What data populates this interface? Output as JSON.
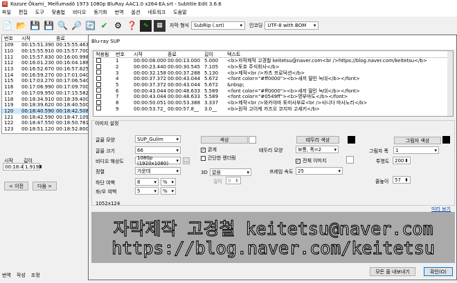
{
  "app": {
    "icon": "SE",
    "title": "Kozure Ōkami_ Meifumadō 1973 1080p BluRay AAC1.0 x264-EA.srt - Subtitle Edit 3.6.6"
  },
  "menu": [
    "파일",
    "편집",
    "도구",
    "맞춤법",
    "비디오",
    "동기화",
    "번역",
    "옵션",
    "네트워크",
    "도움말"
  ],
  "toolbar": {
    "format_label": "자막 형식",
    "format_value": "SubRip (.srt)",
    "encoding_label": "인코딩",
    "encoding_value": "UTF-8 with BOM",
    "icons": [
      "new-file-icon",
      "open-folder-icon",
      "save-icon",
      "save-as-icon",
      "find-icon",
      "replace-icon",
      "sync-icon",
      "spellcheck-icon",
      "settings-icon",
      "help-icon",
      "waveform-icon",
      "video-icon"
    ]
  },
  "left_grid": {
    "headers": [
      "번호",
      "시작",
      "종료"
    ],
    "rows": [
      [
        "109",
        "00:15:51.390",
        "00:15:55.463"
      ],
      [
        "110",
        "00:15:55.910",
        "00:15:57.700"
      ],
      [
        "111",
        "00:15:57.830",
        "00:16:00.998"
      ],
      [
        "112",
        "00:16:01.230",
        "00:16:04.188"
      ],
      [
        "113",
        "00:16:52.670",
        "00:16:57.825"
      ],
      [
        "114",
        "00:16:59.270",
        "00:17:01.040"
      ],
      [
        "115",
        "00:17:03.270",
        "00:17:06.540"
      ],
      [
        "116",
        "00:17:06.990",
        "00:17:09.700"
      ],
      [
        "117",
        "00:17:09.950",
        "00:17:15.582"
      ],
      [
        "118",
        "00:18:34.910",
        "00:18:39.400"
      ],
      [
        "119",
        "00:18:39.620",
        "00:18:40.500"
      ],
      [
        "120",
        "00:18:40.590",
        "00:18:42.508"
      ],
      [
        "121",
        "00:18:42.590",
        "00:18:47.109"
      ],
      [
        "122",
        "00:18:47.550",
        "00:18:50.781"
      ],
      [
        "123",
        "00:18:51.120",
        "00:18:52.800"
      ]
    ],
    "selected_index": 11
  },
  "left_edit": {
    "start_label": "시작",
    "start_value": "00:18:40.590",
    "dur_label": "길이",
    "dur_value": "1.919",
    "prev": "< 이전",
    "next": "다음 >"
  },
  "bottom_tabs": [
    "번역",
    "작성",
    "조정"
  ],
  "dialog": {
    "title": "Blu-ray SUP",
    "grid_headers": [
      "적용됨",
      "번호",
      "시작",
      "종료",
      "길이",
      "텍스트"
    ],
    "grid_rows": [
      [
        "1",
        "00:00:08.000",
        "00:00:13.000",
        "5.000",
        "<b>자막제작 고경철 keitetsu@naver.com<br />https://blog.naver.com/keitetsu</b>"
      ],
      [
        "2",
        "00:00:23.440",
        "00:00:30.545",
        "7.105",
        "<b>토호 주식회사</b>"
      ],
      [
        "3",
        "00:00:32.158",
        "00:00:37.288",
        "5.130",
        "<b>제작<br />카츠 프로덕션</b>"
      ],
      [
        "4",
        "00:00:37.372",
        "00:00:43.044",
        "5.672",
        "<font color=\"#ff0000\"><b>새끼 딸린 늑대</b></font>"
      ],
      [
        "5",
        "00:00:37.372",
        "00:00:43.044",
        "5.672",
        "&nbsp;"
      ],
      [
        "6",
        "00:00:43.044",
        "00:00:48.633",
        "5.589",
        "<font color=\"#ff0000\"><b>새끼 딸린 늑대</b></font>"
      ],
      [
        "7",
        "00:00:43.044",
        "00:00:48.633",
        "5.589",
        "<font color=\"#0549ff\"><b>명부마도</b></font>"
      ],
      [
        "8",
        "00:00:50.051",
        "00:00:53.388",
        "3.337",
        "<b>제작<br />와카야마 토미사부로<br />사니다 마사노리</b>"
      ],
      [
        "9",
        "00:00:53.72_",
        "00:00:57.8__",
        "3.0__",
        "<b>원작 고이케 카즈오 코지마 고세키</b>"
      ]
    ],
    "image_settings": "이미지 설정",
    "font_name_label": "글꼴 모양",
    "font_name_value": "SUP_Gulim",
    "font_size_label": "글꼴 크기",
    "font_size_value": "66",
    "video_res_label": "비디오 해상도",
    "video_res_value": "1080p (1920x1080)",
    "align_label": "정렬",
    "align_value": "가운데",
    "bottom_margin_label": "하단 여백",
    "bottom_margin_value": "8",
    "bottom_margin_unit": "%",
    "lr_margin_label": "좌/우 여백",
    "lr_margin_value": "5",
    "lr_margin_unit": "%",
    "color_btn": "색상",
    "bold_label": "굵게",
    "simple_render_label": "간단한 렌더링",
    "threed_label": "3D",
    "threed_value": "없음",
    "depth_label": "깊이",
    "depth_value": "0",
    "border_color_btn": "테두리 색상",
    "border_style_label": "테두리 모양",
    "border_style_value": "보통, 폭=2",
    "full_image_label": "전체 이미지",
    "framerate_label": "프레임 속도",
    "framerate_value": "25",
    "shadow_color_btn": "그림자 색상",
    "shadow_width_label": "그림자 폭",
    "shadow_width_value": "1",
    "transparency_label": "투명도",
    "transparency_value": "200",
    "line_height_label": "줄높이",
    "line_height_value": "57",
    "preview_size": "1052x124",
    "preview_link": "미리 보기",
    "preview_line1": "자막제작 고경철 keitetsu@naver.com",
    "preview_line2": "https://blog.naver.com/keitetsu",
    "export_all": "모든 줄 내보내기",
    "ok": "확인(O)"
  }
}
